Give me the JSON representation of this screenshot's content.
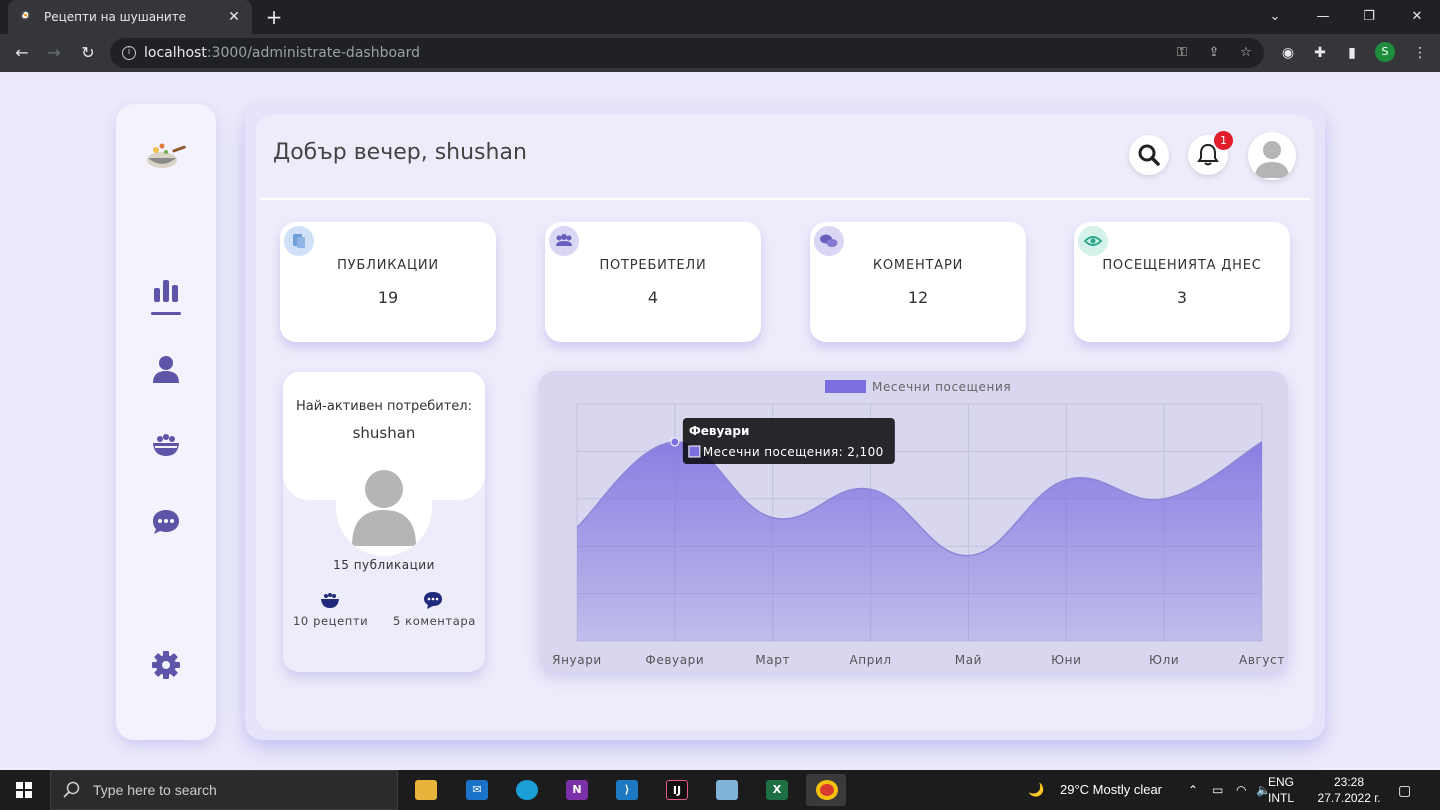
{
  "browser": {
    "tab_title": "Рецепти на шушаните",
    "close_tab": "✕",
    "new_tab": "+",
    "url_host": "localhost",
    "url_path": ":3000/administrate-dashboard",
    "profile_letter": "S"
  },
  "header": {
    "greeting": "Добър вечер, shushan",
    "notification_count": "1"
  },
  "stats": [
    {
      "label": "ПУБЛИКАЦИИ",
      "value": "19",
      "icon": "documents-icon",
      "icon_color": "#cfe0f7"
    },
    {
      "label": "ПОТРЕБИТЕЛИ",
      "value": "4",
      "icon": "users-icon",
      "icon_color": "#d9d7f3"
    },
    {
      "label": "КОМЕНТАРИ",
      "value": "12",
      "icon": "comments-icon",
      "icon_color": "#d9d7f3"
    },
    {
      "label": "ПОСЕЩЕНИЯТА ДНЕС",
      "value": "3",
      "icon": "eye-icon",
      "icon_color": "#d4f1ea"
    }
  ],
  "top_user": {
    "title": "Най-активен потребител:",
    "name": "shushan",
    "publications": "15 публикации",
    "recipes": "10 рецепти",
    "comments": "5 коментара"
  },
  "chart_data": {
    "type": "area",
    "legend": "Месечни посещения",
    "categories": [
      "Януари",
      "Февуари",
      "Март",
      "Април",
      "Май",
      "Юни",
      "Юли",
      "Август"
    ],
    "series": [
      {
        "name": "Месечни посещения",
        "values": [
          1200,
          2100,
          1300,
          1600,
          900,
          1700,
          1500,
          2100
        ]
      }
    ],
    "ylim": [
      0,
      2500
    ],
    "tooltip": {
      "title": "Февуари",
      "text": "Месечни посещения: 2,100"
    },
    "fill_color": "#7b6fe0",
    "grid": true,
    "legend_position": "top"
  },
  "taskbar": {
    "search_placeholder": "Type here to search",
    "weather": "29°C  Mostly clear",
    "lang1": "ENG",
    "lang2": "INTL",
    "time": "23:28",
    "date": "27.7.2022 г."
  }
}
